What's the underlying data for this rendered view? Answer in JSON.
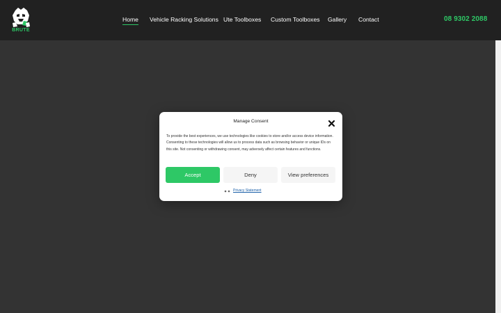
{
  "header": {
    "logo_text": "BRUTE",
    "nav": [
      {
        "label": "Home",
        "active": true
      },
      {
        "label": "Vehicle Racking Solutions",
        "active": false
      },
      {
        "label": "Ute Toolboxes",
        "active": false
      },
      {
        "label": "Custom Toolboxes",
        "active": false
      },
      {
        "label": "Gallery",
        "active": false
      },
      {
        "label": "Contact",
        "active": false
      }
    ],
    "phone": "08 9302 2088"
  },
  "consent": {
    "title": "Manage Consent",
    "body": "To provide the best experiences, we use technologies like cookies to store and/or access device information. Consenting to these technologies will allow us to process data such as browsing behavior or unique IDs on this site. Not consenting or withdrawing consent, may adversely affect certain features and functions.",
    "accept_label": "Accept",
    "deny_label": "Deny",
    "preferences_label": "View preferences",
    "privacy_link": "Privacy Statement"
  },
  "colors": {
    "accent": "#2ec866",
    "header_bg": "#212121",
    "page_bg": "#333333"
  },
  "icons": {
    "logo": "bulldog-logo-icon",
    "close": "close-icon"
  }
}
